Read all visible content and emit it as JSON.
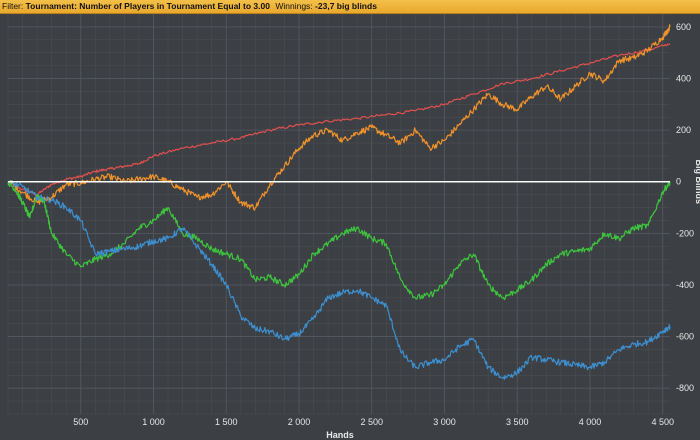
{
  "filter_bar": {
    "filter_label": "Filter:",
    "filter_value": "Tournament: Number of Players in Tournament Equal to 3.00",
    "winnings_label": "Winnings:",
    "winnings_value": "-23,7 big blinds"
  },
  "colors": {
    "background": "#3c3f43",
    "grid": "#555a60",
    "zero_line": "#ffffff",
    "filter_bar": "#efb63b"
  },
  "chart_data": {
    "type": "line",
    "xlabel": "Hands",
    "ylabel": "Big Blinds",
    "xlim": [
      0,
      4550
    ],
    "ylim": [
      -900,
      650
    ],
    "xticks": [
      500,
      1000,
      1500,
      2000,
      2500,
      3000,
      3500,
      4000,
      4500
    ],
    "xtick_labels": [
      "500",
      "1 000",
      "1 500",
      "2 000",
      "2 500",
      "3 000",
      "3 500",
      "4 000",
      "4 500"
    ],
    "yticks": [
      -800,
      -600,
      -400,
      -200,
      0,
      200,
      400,
      600
    ],
    "ytick_labels": [
      "-800",
      "-600",
      "-400",
      "-200",
      "0",
      "200",
      "400",
      "600"
    ],
    "zero_line": 0,
    "grid": true,
    "series": [
      {
        "color": "#e05050",
        "x": [
          0,
          100,
          200,
          300,
          400,
          500,
          600,
          700,
          800,
          900,
          1000,
          1200,
          1400,
          1600,
          1800,
          2000,
          2200,
          2400,
          2600,
          2800,
          3000,
          3200,
          3400,
          3600,
          3800,
          4000,
          4200,
          4400,
          4550
        ],
        "y": [
          0,
          -30,
          -50,
          -10,
          10,
          20,
          40,
          50,
          60,
          70,
          100,
          130,
          150,
          170,
          200,
          220,
          235,
          245,
          260,
          275,
          300,
          340,
          380,
          400,
          430,
          460,
          490,
          510,
          535
        ]
      },
      {
        "color": "#f0922b",
        "x": [
          0,
          100,
          200,
          300,
          400,
          500,
          600,
          700,
          800,
          900,
          1000,
          1100,
          1200,
          1300,
          1400,
          1500,
          1600,
          1700,
          1800,
          1900,
          2000,
          2100,
          2200,
          2300,
          2400,
          2500,
          2600,
          2700,
          2800,
          2900,
          3000,
          3100,
          3200,
          3300,
          3400,
          3500,
          3600,
          3700,
          3800,
          3900,
          4000,
          4100,
          4200,
          4300,
          4400,
          4500,
          4550
        ],
        "y": [
          0,
          -40,
          -80,
          -60,
          -10,
          -5,
          10,
          20,
          0,
          10,
          20,
          0,
          -30,
          -60,
          -50,
          0,
          -80,
          -100,
          -10,
          60,
          130,
          180,
          200,
          160,
          190,
          210,
          180,
          150,
          200,
          130,
          160,
          220,
          280,
          340,
          300,
          280,
          330,
          370,
          320,
          370,
          420,
          390,
          470,
          480,
          510,
          560,
          600
        ]
      },
      {
        "color": "#3ec43e",
        "x": [
          0,
          50,
          100,
          150,
          200,
          250,
          300,
          400,
          500,
          600,
          700,
          800,
          900,
          1000,
          1100,
          1200,
          1300,
          1400,
          1500,
          1600,
          1700,
          1800,
          1900,
          2000,
          2100,
          2200,
          2300,
          2400,
          2500,
          2600,
          2700,
          2800,
          2900,
          3000,
          3100,
          3200,
          3300,
          3400,
          3500,
          3600,
          3700,
          3800,
          3900,
          4000,
          4100,
          4200,
          4300,
          4400,
          4500,
          4550
        ],
        "y": [
          0,
          -30,
          -80,
          -140,
          -50,
          -80,
          -200,
          -280,
          -330,
          -300,
          -280,
          -240,
          -180,
          -150,
          -100,
          -200,
          -220,
          -260,
          -280,
          -300,
          -380,
          -370,
          -400,
          -360,
          -280,
          -240,
          -200,
          -180,
          -220,
          -240,
          -380,
          -450,
          -440,
          -400,
          -320,
          -280,
          -400,
          -450,
          -420,
          -380,
          -320,
          -280,
          -270,
          -260,
          -200,
          -220,
          -180,
          -170,
          -40,
          0
        ]
      },
      {
        "color": "#3d8fd0",
        "x": [
          0,
          100,
          200,
          300,
          400,
          500,
          600,
          700,
          800,
          900,
          1000,
          1100,
          1200,
          1300,
          1400,
          1500,
          1600,
          1700,
          1800,
          1900,
          2000,
          2100,
          2200,
          2300,
          2400,
          2500,
          2600,
          2700,
          2800,
          2900,
          3000,
          3100,
          3200,
          3300,
          3400,
          3500,
          3600,
          3700,
          3800,
          3900,
          4000,
          4100,
          4200,
          4300,
          4400,
          4500,
          4550
        ],
        "y": [
          0,
          -20,
          -60,
          -70,
          -100,
          -150,
          -280,
          -270,
          -260,
          -250,
          -230,
          -220,
          -180,
          -250,
          -320,
          -400,
          -520,
          -570,
          -580,
          -610,
          -590,
          -530,
          -450,
          -430,
          -420,
          -450,
          -480,
          -660,
          -720,
          -700,
          -690,
          -640,
          -610,
          -720,
          -760,
          -740,
          -680,
          -690,
          -700,
          -710,
          -720,
          -700,
          -650,
          -630,
          -620,
          -580,
          -560
        ]
      }
    ]
  }
}
